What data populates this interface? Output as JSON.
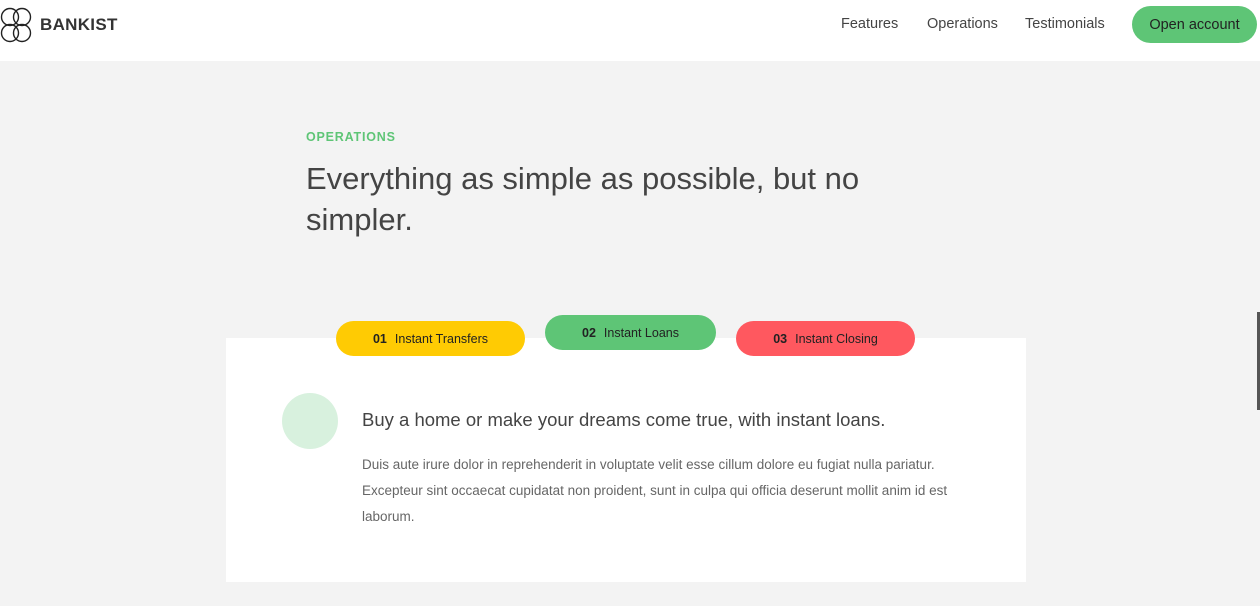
{
  "nav": {
    "brand": "BANKIST",
    "links": [
      "Features",
      "Operations",
      "Testimonials"
    ],
    "cta": "Open account"
  },
  "section": {
    "label": "OPERATIONS",
    "title": "Everything as simple as possible, but no simpler."
  },
  "tabs": [
    {
      "num": "01",
      "label": "Instant Transfers",
      "color": "#ffcb03"
    },
    {
      "num": "02",
      "label": "Instant Loans",
      "color": "#5ec576"
    },
    {
      "num": "03",
      "label": "Instant Closing",
      "color": "#ff585f"
    }
  ],
  "content": {
    "heading": "Buy a home or make your dreams come true, with instant loans.",
    "text": "Duis aute irure dolor in reprehenderit in voluptate velit esse cillum dolore eu fugiat nulla pariatur. Excepteur sint occaecat cupidatat non proident, sunt in culpa qui officia deserunt mollit anim id est laborum."
  },
  "colors": {
    "accent": "#5ec576",
    "background": "#f3f3f3"
  },
  "icons": {
    "logo": "four-circle-logo-icon",
    "content": "circle-icon"
  }
}
